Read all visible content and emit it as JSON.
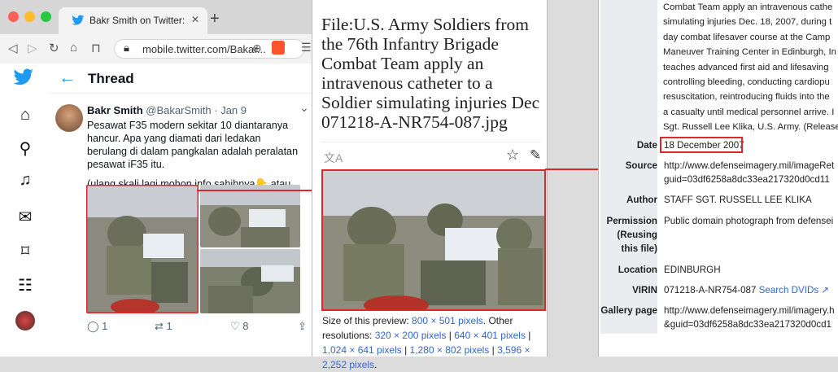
{
  "browser": {
    "tab_title": "Bakr Smith on Twitter: \"Sumber da",
    "new_tab": "+",
    "url": "mobile.twitter.com/Bakar...",
    "close_glyph": "✕"
  },
  "twitter": {
    "thread_title": "Thread",
    "tweet": {
      "name": "Bakr Smith",
      "handle": "@BakarSmith · Jan 9",
      "text_1": "Pesawat F35 modern sekitar 10 diantaranya hancur. Apa yang diamati dari ledakan berulang di dalam pangkalan adalah peralatan pesawat iF35 itu.",
      "text_2": "(ulang skali lagi mohon info sahihnya",
      "text_2_emoji": "👇",
      "text_2_end": " atau hoax?)",
      "more": "⌄"
    },
    "actions": {
      "replies": "1",
      "retweets": "1",
      "likes": "8"
    }
  },
  "wiki_mobile": {
    "title": "File:U.S. Army Soldiers from the 76th Infantry Brigade Combat Team apply an intravenous catheter to a Soldier simulating injuries Dec 071218-A-NR754-087.jpg",
    "preview_label": "Size of this preview: ",
    "preview_size": "800 × 501 pixels",
    "other_label": ". Other resolutions: ",
    "res_1": "320 × 200 pixels",
    "res_2": "640 × 401 pixels",
    "res_3": "1,024 × 641 pixels",
    "res_4": "1,280 × 802 pixels",
    "res_5": "3,596 × 2,252 pixels",
    "sep": " | ",
    "end": "."
  },
  "wiki_desktop": {
    "description_lines": [
      "Combat Team apply an intravenous cathe",
      "simulating injuries Dec. 18, 2007, during t",
      "day combat lifesaver course at the Camp",
      "Maneuver Training Center in Edinburgh, In",
      "teaches advanced first aid and lifesaving",
      "controlling bleeding, conducting cardiopu",
      "resuscitation, reintroducing fluids into the",
      "a casualty until medical personnel arrive. I",
      "Sgt. Russell Lee Klika, U.S. Army. (Release"
    ],
    "rows": {
      "date_label": "Date",
      "date_value": "18 December 2007",
      "source_label": "Source",
      "source_value_1": "http://www.defenseimagery.mil/imageRet",
      "source_value_2": "guid=03df6258a8dc33ea217320d0cd11",
      "author_label": "Author",
      "author_value": "STAFF SGT. RUSSELL LEE KLIKA",
      "permission_label": "Permission",
      "permission_sub": "(Reusing this file)",
      "permission_value": "Public domain photograph from defensei",
      "location_label": "Location",
      "location_value": "EDINBURGH",
      "virin_label": "VIRIN",
      "virin_value": "071218-A-NR754-087",
      "virin_link": "Search DVIDs",
      "gallery_label": "Gallery page",
      "gallery_value_1": "http://www.defenseimagery.mil/imagery.h",
      "gallery_value_2": "&guid=03df6258a8dc33ea217320d0cd1"
    }
  },
  "colors": {
    "twitter_blue": "#1d9bf0",
    "annotation_red": "#e0262b",
    "wiki_link": "#3366cc"
  }
}
